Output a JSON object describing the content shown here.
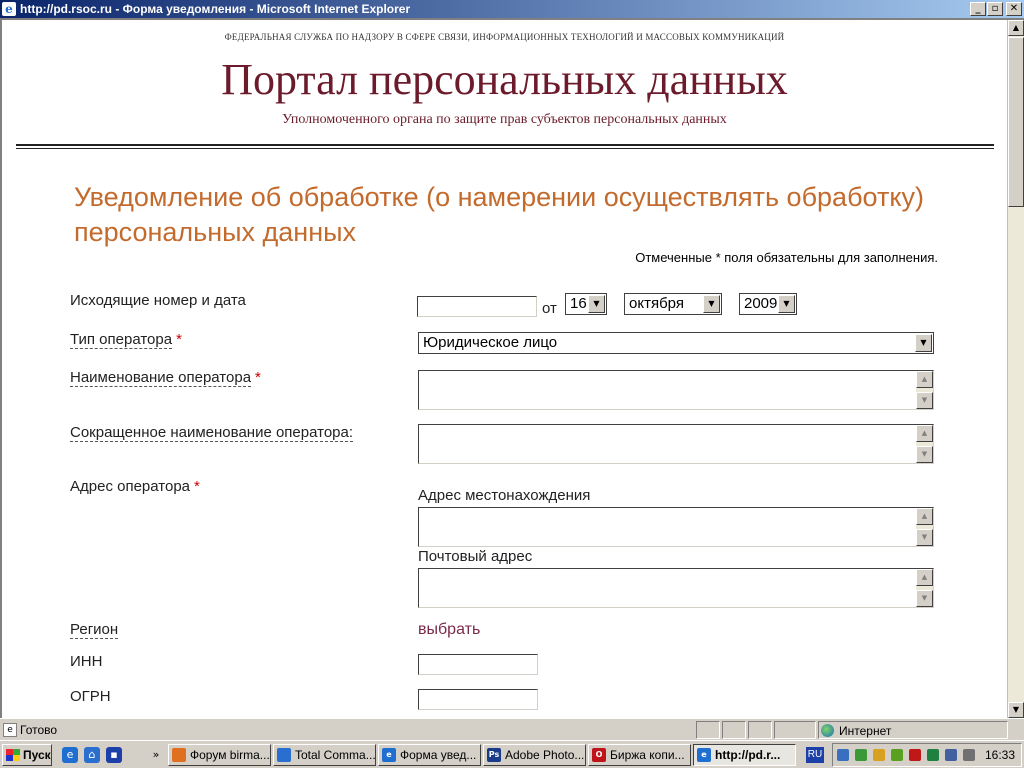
{
  "window": {
    "title": "http://pd.rsoc.ru - Форма уведомления - Microsoft Internet Explorer",
    "controls": [
      "_",
      "▫",
      "✕"
    ]
  },
  "page": {
    "agency_line": "ФЕДЕРАЛЬНАЯ СЛУЖБА ПО НАДЗОРУ В СФЕРЕ СВЯЗИ, ИНФОРМАЦИОННЫХ ТЕХНОЛОГИЙ И МАССОВЫХ КОММУНИКАЦИЙ",
    "portal_title": "Портал персональных данных",
    "portal_subtitle": "Уполномоченного органа по защите прав субъектов персональных данных",
    "heading": "Уведомление об обработке (о намерении осуществлять обработку) персональных данных",
    "required_note": "Отмеченные * поля обязательны для заполнения.",
    "required_mark": "*"
  },
  "form": {
    "outgoing": {
      "label": "Исходящие номер и дата",
      "number_value": "",
      "from_label": "от",
      "day": "16",
      "month": "октября",
      "year": "2009"
    },
    "operator_type": {
      "label": "Тип оператора",
      "value": "Юридическое лицо"
    },
    "operator_name": {
      "label": "Наименование оператора",
      "value": ""
    },
    "short_name": {
      "label": "Сокращенное наименование оператора:",
      "value": ""
    },
    "address": {
      "label": "Адрес оператора",
      "location_label": "Адрес местонахождения",
      "postal_label": "Почтовый адрес"
    },
    "region": {
      "label": "Регион",
      "link": "выбрать"
    },
    "inn": {
      "label": "ИНН",
      "value": ""
    },
    "ogrn": {
      "label": "ОГРН",
      "value": ""
    }
  },
  "statusbar": {
    "status": "Готово",
    "zone": "Интернет"
  },
  "taskbar": {
    "start": "Пуск",
    "tasks": [
      {
        "label": "Форум birma...",
        "icon": "firefox-icon",
        "color": "#e07020"
      },
      {
        "label": "Total Comma...",
        "icon": "total-commander-icon",
        "color": "#2a6fcf"
      },
      {
        "label": "Форма увед...",
        "icon": "ie-icon",
        "color": "#1f6fd0"
      },
      {
        "label": "Adobe Photo...",
        "icon": "photoshop-icon",
        "color": "#1a3a8a"
      },
      {
        "label": "Биржа копи...",
        "icon": "opera-icon",
        "color": "#c0141b"
      },
      {
        "label": "http://pd.r...",
        "icon": "ie-icon",
        "color": "#1f6fd0"
      }
    ],
    "lang": "RU",
    "time": "16:33"
  }
}
